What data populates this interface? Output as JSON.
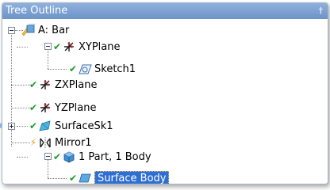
{
  "panel": {
    "title": "Tree Outline",
    "pin_glyph": "†"
  },
  "tree": {
    "root": {
      "label": "A: Bar",
      "expander": "minus"
    },
    "xyplane": {
      "label": "XYPlane",
      "expander": "minus",
      "check": "✔"
    },
    "sketch1": {
      "label": "Sketch1",
      "check": "✔"
    },
    "zxplane": {
      "label": "ZXPlane",
      "check": "✔"
    },
    "yzplane": {
      "label": "YZPlane",
      "check": "✔"
    },
    "surfacesk1": {
      "label": "SurfaceSk1",
      "expander": "plus",
      "check": "✔"
    },
    "mirror1": {
      "label": "Mirror1",
      "check": "✔"
    },
    "part": {
      "label": "1 Part, 1 Body",
      "expander": "minus",
      "check": "✔"
    },
    "surfacebody": {
      "label": "Surface Body",
      "check": "✔"
    }
  },
  "colors": {
    "titlebar": "#7aa0d3",
    "selection": "#2f6fd1",
    "check": "#1a9a2a"
  },
  "icons": [
    "root-model-icon",
    "plane-icon",
    "sketch-icon",
    "surface-sketch-icon",
    "mirror-icon",
    "part-icon",
    "surface-body-icon"
  ]
}
